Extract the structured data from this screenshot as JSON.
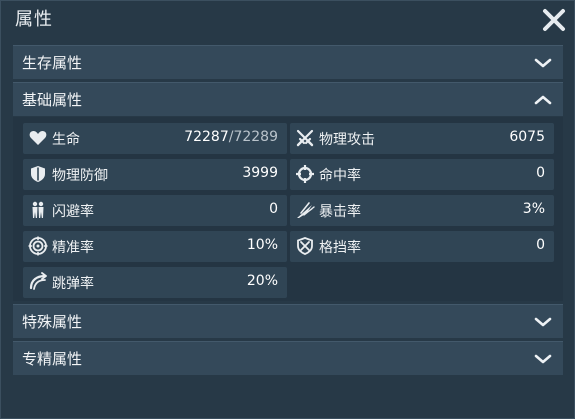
{
  "window": {
    "title": "属性"
  },
  "sections": {
    "survival": {
      "label": "生存属性",
      "state": "collapsed"
    },
    "basic": {
      "label": "基础属性",
      "state": "expanded"
    },
    "special": {
      "label": "特殊属性",
      "state": "collapsed"
    },
    "expert": {
      "label": "专精属性",
      "state": "collapsed"
    }
  },
  "stats": {
    "hp": {
      "label": "生命",
      "value": "72287",
      "sep": "/",
      "max": "72289",
      "icon": "heart-icon"
    },
    "phys_atk": {
      "label": "物理攻击",
      "value": "6075",
      "icon": "crossed-swords-icon"
    },
    "phys_def": {
      "label": "物理防御",
      "value": "3999",
      "icon": "shield-icon"
    },
    "hit_rate": {
      "label": "命中率",
      "value": "0",
      "icon": "crosshair-icon"
    },
    "dodge": {
      "label": "闪避率",
      "value": "0",
      "icon": "dodge-figures-icon"
    },
    "crit": {
      "label": "暴击率",
      "value": "3%",
      "icon": "slash-icon"
    },
    "precision": {
      "label": "精准率",
      "value": "10%",
      "icon": "target-icon"
    },
    "block": {
      "label": "格挡率",
      "value": "0",
      "icon": "block-shield-icon"
    },
    "ricochet": {
      "label": "跳弹率",
      "value": "20%",
      "icon": "ricochet-icon"
    }
  },
  "colors": {
    "panel": "#273947",
    "header": "#34495a",
    "cell": "#304555",
    "text": "#f2f4f6"
  }
}
